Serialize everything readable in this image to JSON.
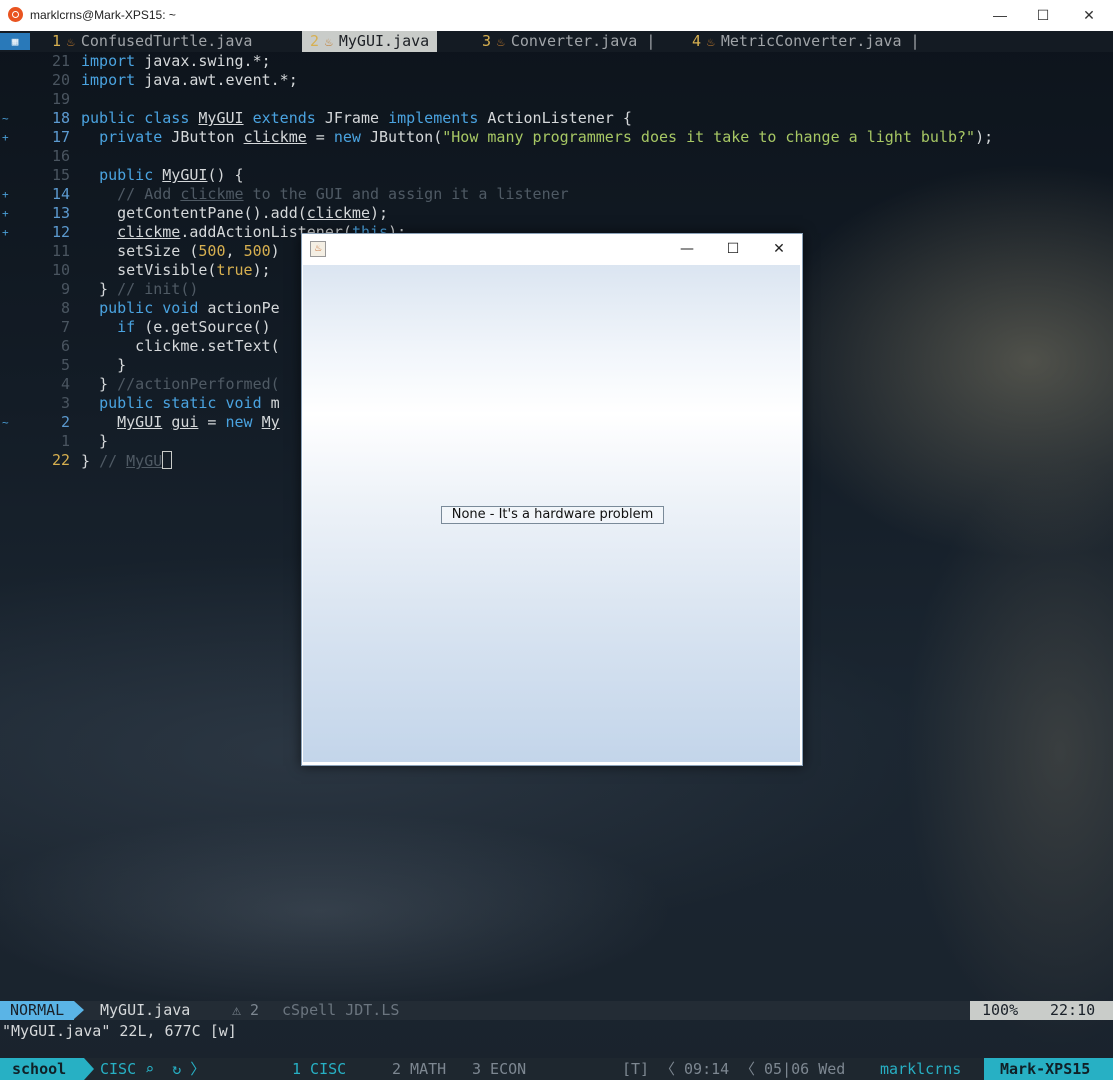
{
  "window": {
    "title": "marklcrns@Mark-XPS15: ~",
    "minimize": "—",
    "maximize": "☐",
    "close": "✕"
  },
  "tabs": [
    {
      "num": "1",
      "name": "ConfusedTurtle.java",
      "active": false
    },
    {
      "num": "2",
      "name": "MyGUI.java",
      "active": true
    },
    {
      "num": "3",
      "name": "Converter.java |",
      "active": false
    },
    {
      "num": "4",
      "name": "MetricConverter.java |",
      "active": false
    }
  ],
  "tab_menu_icon": "grid-icon",
  "code": {
    "lines": [
      {
        "ln": "21",
        "text": "import javax.swing.*;"
      },
      {
        "ln": "20",
        "text": "import java.awt.event.*;"
      },
      {
        "ln": "19",
        "text": ""
      },
      {
        "ln": "18",
        "text": "public class MyGUI extends JFrame implements ActionListener {"
      },
      {
        "ln": "17",
        "text": "  private JButton clickme = new JButton(\"How many programmers does it take to change a light bulb?\");"
      },
      {
        "ln": "16",
        "text": ""
      },
      {
        "ln": "15",
        "text": "  public MyGUI() {"
      },
      {
        "ln": "14",
        "text": "    // Add clickme to the GUI and assign it a listener"
      },
      {
        "ln": "13",
        "text": "    getContentPane().add(clickme);"
      },
      {
        "ln": "12",
        "text": "    clickme.addActionListener(this);"
      },
      {
        "ln": "11",
        "text": "    setSize (500, 500)"
      },
      {
        "ln": "10",
        "text": "    setVisible(true);"
      },
      {
        "ln": "9",
        "text": "  } // init()"
      },
      {
        "ln": "8",
        "text": "  public void actionPe"
      },
      {
        "ln": "7",
        "text": "    if (e.getSource()"
      },
      {
        "ln": "6",
        "text": "      clickme.setText("
      },
      {
        "ln": "5",
        "text": "    }"
      },
      {
        "ln": "4",
        "text": "  } //actionPerformed("
      },
      {
        "ln": "3",
        "text": "  public static void m"
      },
      {
        "ln": "2",
        "text": "    MyGUI gui = new My"
      },
      {
        "ln": "1",
        "text": "  }"
      },
      {
        "ln": "22",
        "text": "} // MyGUI"
      }
    ]
  },
  "statusline": {
    "mode": "NORMAL",
    "file": "MyGUI.java",
    "warnings": "⚠ 2",
    "tools": "cSpell JDT.LS",
    "percent": "100%",
    "position": "22:10"
  },
  "cmdline": "\"MyGUI.java\" 22L, 677C [w]",
  "tmux": {
    "session": "school",
    "window_name": "CISC",
    "windows": [
      "1 CISC",
      "2 MATH",
      "3 ECON"
    ],
    "flag": "[T]",
    "time": "09:14",
    "date": "05|06 Wed",
    "user": "marklcrns",
    "host": "Mark-XPS15"
  },
  "java_window": {
    "button_text": "None - It's a hardware problem",
    "minimize": "—",
    "maximize": "☐",
    "close": "✕"
  },
  "colors": {
    "mode_bg": "#5ab4e6",
    "tmux_accent": "#27b0c4",
    "line_number_current": "#d7b050"
  }
}
